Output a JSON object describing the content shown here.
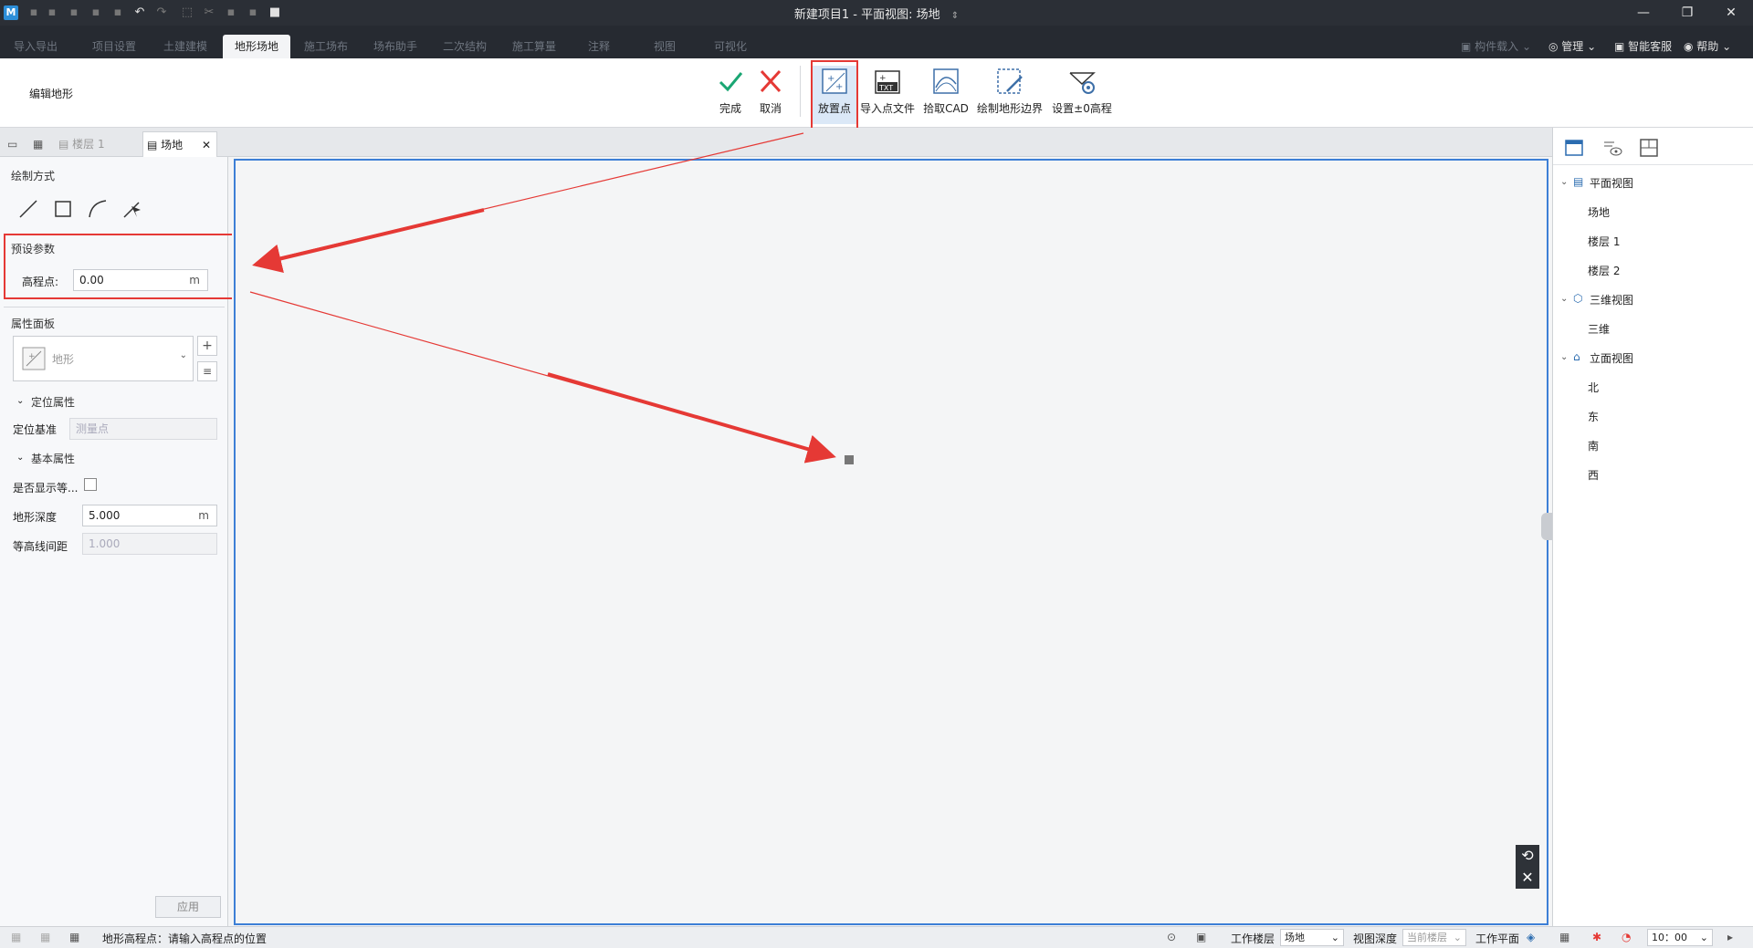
{
  "app": {
    "title": "新建项目1 - 平面视图: 场地",
    "title_arrow": "⇕",
    "logo": "M"
  },
  "window_controls": {
    "minimize": "—",
    "restore": "❐",
    "close": "✕"
  },
  "menu": {
    "tabs": [
      "导入导出",
      "项目设置",
      "土建建模",
      "地形场地",
      "施工场布",
      "场布助手",
      "二次结构",
      "施工算量",
      "注释",
      "视图",
      "可视化"
    ],
    "active_tab": "地形场地",
    "component_load": "构件载入",
    "manage": "管理",
    "smart_service": "智能客服",
    "help": "帮助"
  },
  "ribbon": {
    "group_label": "编辑地形",
    "finish": "完成",
    "cancel": "取消",
    "place_point": "放置点",
    "import_point_file": "导入点文件",
    "pick_cad": "拾取CAD",
    "draw_boundary": "绘制地形边界",
    "set_zero_elevation": "设置±0高程",
    "txt_icon_text": "TXT"
  },
  "doc_tabs": {
    "tab1": "楼层 1",
    "tab2": "场地"
  },
  "left_panel": {
    "draw_method_title": "绘制方式",
    "preset_title": "预设参数",
    "elevation_label": "高程点:",
    "elevation_value": "0.00",
    "elevation_unit": "m",
    "property_panel_title": "属性面板",
    "type_name": "地形",
    "positioning_section": "定位属性",
    "positioning_base_label": "定位基准",
    "positioning_base_value": "测量点",
    "basic_section": "基本属性",
    "show_contour_label": "是否显示等...",
    "terrain_depth_label": "地形深度",
    "terrain_depth_value": "5.000",
    "terrain_depth_unit": "m",
    "contour_interval_label": "等高线间距",
    "contour_interval_value": "1.000",
    "apply_button": "应用"
  },
  "right_panel": {
    "tree": [
      {
        "label": "平面视图",
        "children": [
          "场地",
          "楼层 1",
          "楼层 2"
        ]
      },
      {
        "label": "三维视图",
        "children": [
          "三维"
        ]
      },
      {
        "label": "立面视图",
        "children": [
          "北",
          "东",
          "南",
          "西"
        ]
      }
    ]
  },
  "status_bar": {
    "prompt": "地形高程点：请输入高程点的位置",
    "work_floor_label": "工作楼层",
    "work_floor_value": "场地",
    "view_depth_label": "视图深度",
    "view_depth_value": "当前楼层",
    "work_plane_label": "工作平面",
    "scale_value": "10：00"
  },
  "colors": {
    "accent_blue": "#3d7fd6",
    "annotation_red": "#e53935",
    "finish_green": "#1aa673",
    "dark_chrome": "#262a31"
  }
}
